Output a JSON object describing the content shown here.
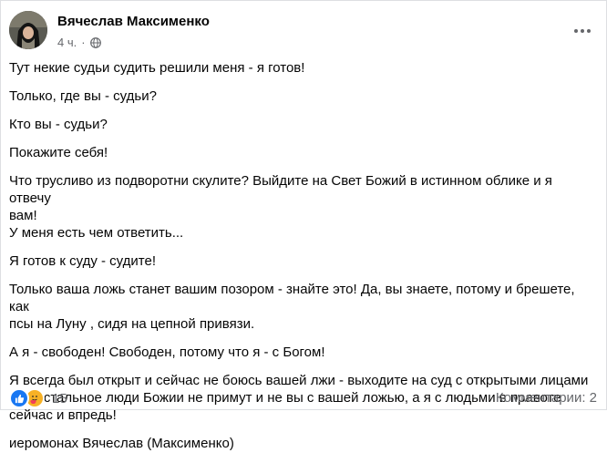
{
  "post": {
    "author": "Вячеслав Максименко",
    "time": "4 ч.",
    "separator": "·",
    "privacy_icon": "globe-icon",
    "more_icon": "more-horizontal-icon",
    "paragraphs": [
      "Тут некие судьи судить решили меня - я готов!",
      "Только, где вы - судьи?",
      "Кто вы - судьи?",
      "Покажите себя!",
      "Что трусливо из подворотни скулите? Выйдите на Свет Божий в истинном облике и я отвечу\nвам!\nУ меня есть чем ответить...",
      "Я готов к суду - судите!",
      "Только ваша ложь станет вашим позором - знайте это! Да, вы знаете, потому и брешете, как\nпсы на Луну , сидя на цепной привязи.",
      "А я - свободен! Свободен, потому что я - с Богом!",
      "Я всегда был открыт и сейчас не боюсь вашей лжи - выходите на суд с открытыми лицами\nибо остальное люди Божии не примут и не вы с вашей ложью, а я с людьми в правоте\nсейчас и впредь!",
      "иеромонах Вячеслав (Максименко)"
    ]
  },
  "footer": {
    "reaction_icons": [
      "like-icon",
      "care-icon"
    ],
    "reaction_count": "15",
    "comments_label": "Комментарии: 2"
  },
  "colors": {
    "text": "#050505",
    "secondary": "#65676b",
    "like_blue": "#1877f2",
    "care_yellow": "#f7b125"
  }
}
